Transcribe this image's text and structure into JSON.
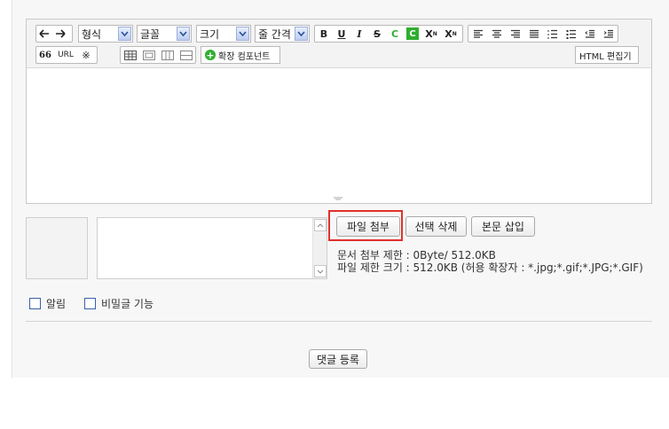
{
  "toolbar": {
    "undo_label": "",
    "format_select": "형식",
    "font_select": "글꼴",
    "size_select": "크기",
    "lineheight_select": "줄 간격",
    "bold": "B",
    "underline": "U",
    "italic": "I",
    "strike": "S",
    "font_color": "C",
    "bg_color": "C",
    "superscript": "X",
    "subscript": "X",
    "quote_label": "66",
    "url_label": "URL",
    "special_char": "※",
    "extension_component": "확장 컴포넌트",
    "html_editor": "HTML 편집기"
  },
  "attachments": {
    "attach_button": "파일 첨부",
    "delete_selected_button": "선택 삭제",
    "insert_body_button": "본문 삽입",
    "doc_limit": "문서 첨부 제한 : 0Byte/ 512.0KB",
    "file_limit": "파일 제한 크기 : 512.0KB (허용 확장자 : *.jpg;*.gif;*.JPG;*.GIF)"
  },
  "options": {
    "notify_label": "알림",
    "secret_label": "비밀글 기능"
  },
  "submit_label": "댓글 등록"
}
